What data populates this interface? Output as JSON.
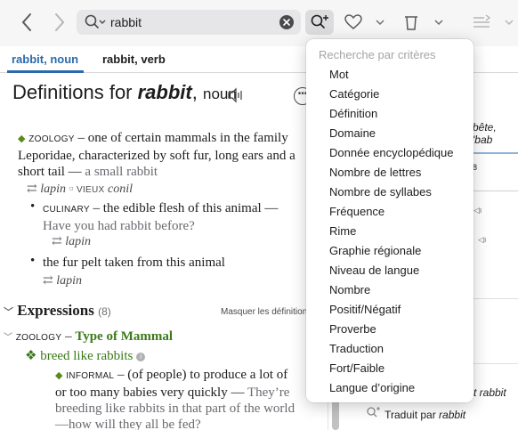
{
  "toolbar": {
    "search_value": "rabbit"
  },
  "tabs": [
    {
      "label": "rabbit, noun"
    },
    {
      "label": "rabbit, verb"
    }
  ],
  "definition": {
    "prefix": "Definitions for ",
    "word": "rabbit",
    "sep": ", ",
    "pos": "noun",
    "senses": [
      {
        "label": "zoology",
        "text": " – one of certain mammals in the family Leporidae, characterized by soft fur, long ears and a short tail — ",
        "example": "a small rabbit",
        "synonym": "lapin",
        "syn_sep": " ▫ ",
        "syn_label": "vieux",
        "syn2": "conil"
      },
      {
        "label": "culinary",
        "text": " – the edible flesh of this animal — ",
        "example": "Have you had rabbit before?",
        "synonym": "lapin"
      },
      {
        "text": "the fur pelt taken from this animal",
        "synonym": "lapin"
      }
    ]
  },
  "expressions": {
    "title": "Expressions",
    "count": "(8)",
    "hide_label": "Masquer les définitions",
    "group_label": "zoology",
    "group_title": "Type of Mammal",
    "dash": " – ",
    "phrase": "breed like rabbits",
    "info": "i",
    "sub_label": "informal",
    "sub_text": " – (of people) to produce a lot of or too many babies very quickly — ",
    "sub_example": "They’re breeding like rabbits in that part of the world—how will they all be fed?"
  },
  "right_panel": {
    "frag1": "bête, 'bab",
    "frag2": "8",
    "frag3": "t rabbit",
    "translated_by_prefix": "Traduit par ",
    "translated_by_word": "rabbit"
  },
  "dropdown": {
    "header": "Recherche par critères",
    "items": [
      "Mot",
      "Catégorie",
      "Définition",
      "Domaine",
      "Donnée encyclopédique",
      "Nombre de lettres",
      "Nombre de syllabes",
      "Fréquence",
      "Rime",
      "Graphie régionale",
      "Niveau de langue",
      "Nombre",
      "Positif/Négatif",
      "Proverbe",
      "Traduction",
      "Fort/Faible",
      "Langue d’origine"
    ]
  }
}
